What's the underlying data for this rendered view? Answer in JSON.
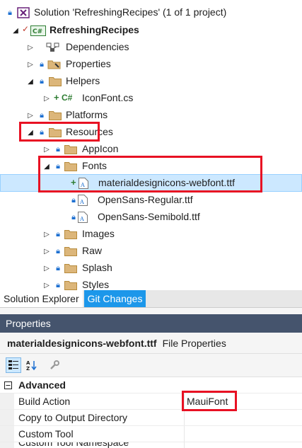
{
  "solution_explorer": {
    "solution_label": "Solution 'RefreshingRecipes' (1 of 1 project)",
    "project_label": "RefreshingRecipes",
    "items": {
      "dependencies": "Dependencies",
      "properties": "Properties",
      "helpers": "Helpers",
      "iconfont": "IconFont.cs",
      "platforms": "Platforms",
      "resources": "Resources",
      "appicon": "AppIcon",
      "fonts": "Fonts",
      "font_mdi": "materialdesignicons-webfont.ttf",
      "font_regular": "OpenSans-Regular.ttf",
      "font_semibold": "OpenSans-Semibold.ttf",
      "images": "Images",
      "raw": "Raw",
      "splash": "Splash",
      "styles": "Styles"
    }
  },
  "tabs": {
    "solution_explorer": "Solution Explorer",
    "git_changes": "Git Changes"
  },
  "properties": {
    "header": "Properties",
    "file_name": "materialdesignicons-webfont.ttf",
    "file_kind": "File Properties",
    "section": "Advanced",
    "rows": {
      "build_action_name": "Build Action",
      "build_action_value": "MauiFont",
      "copy_name": "Copy to Output Directory",
      "copy_value": "",
      "custom_tool_name": "Custom Tool",
      "custom_tool_value": "",
      "custom_ns_name": "Custom Tool Namespace"
    }
  },
  "colors": {
    "highlight": "#e81123",
    "selection": "#cce8ff",
    "header_bg": "#45546d",
    "lock": "#1c6fd1"
  }
}
